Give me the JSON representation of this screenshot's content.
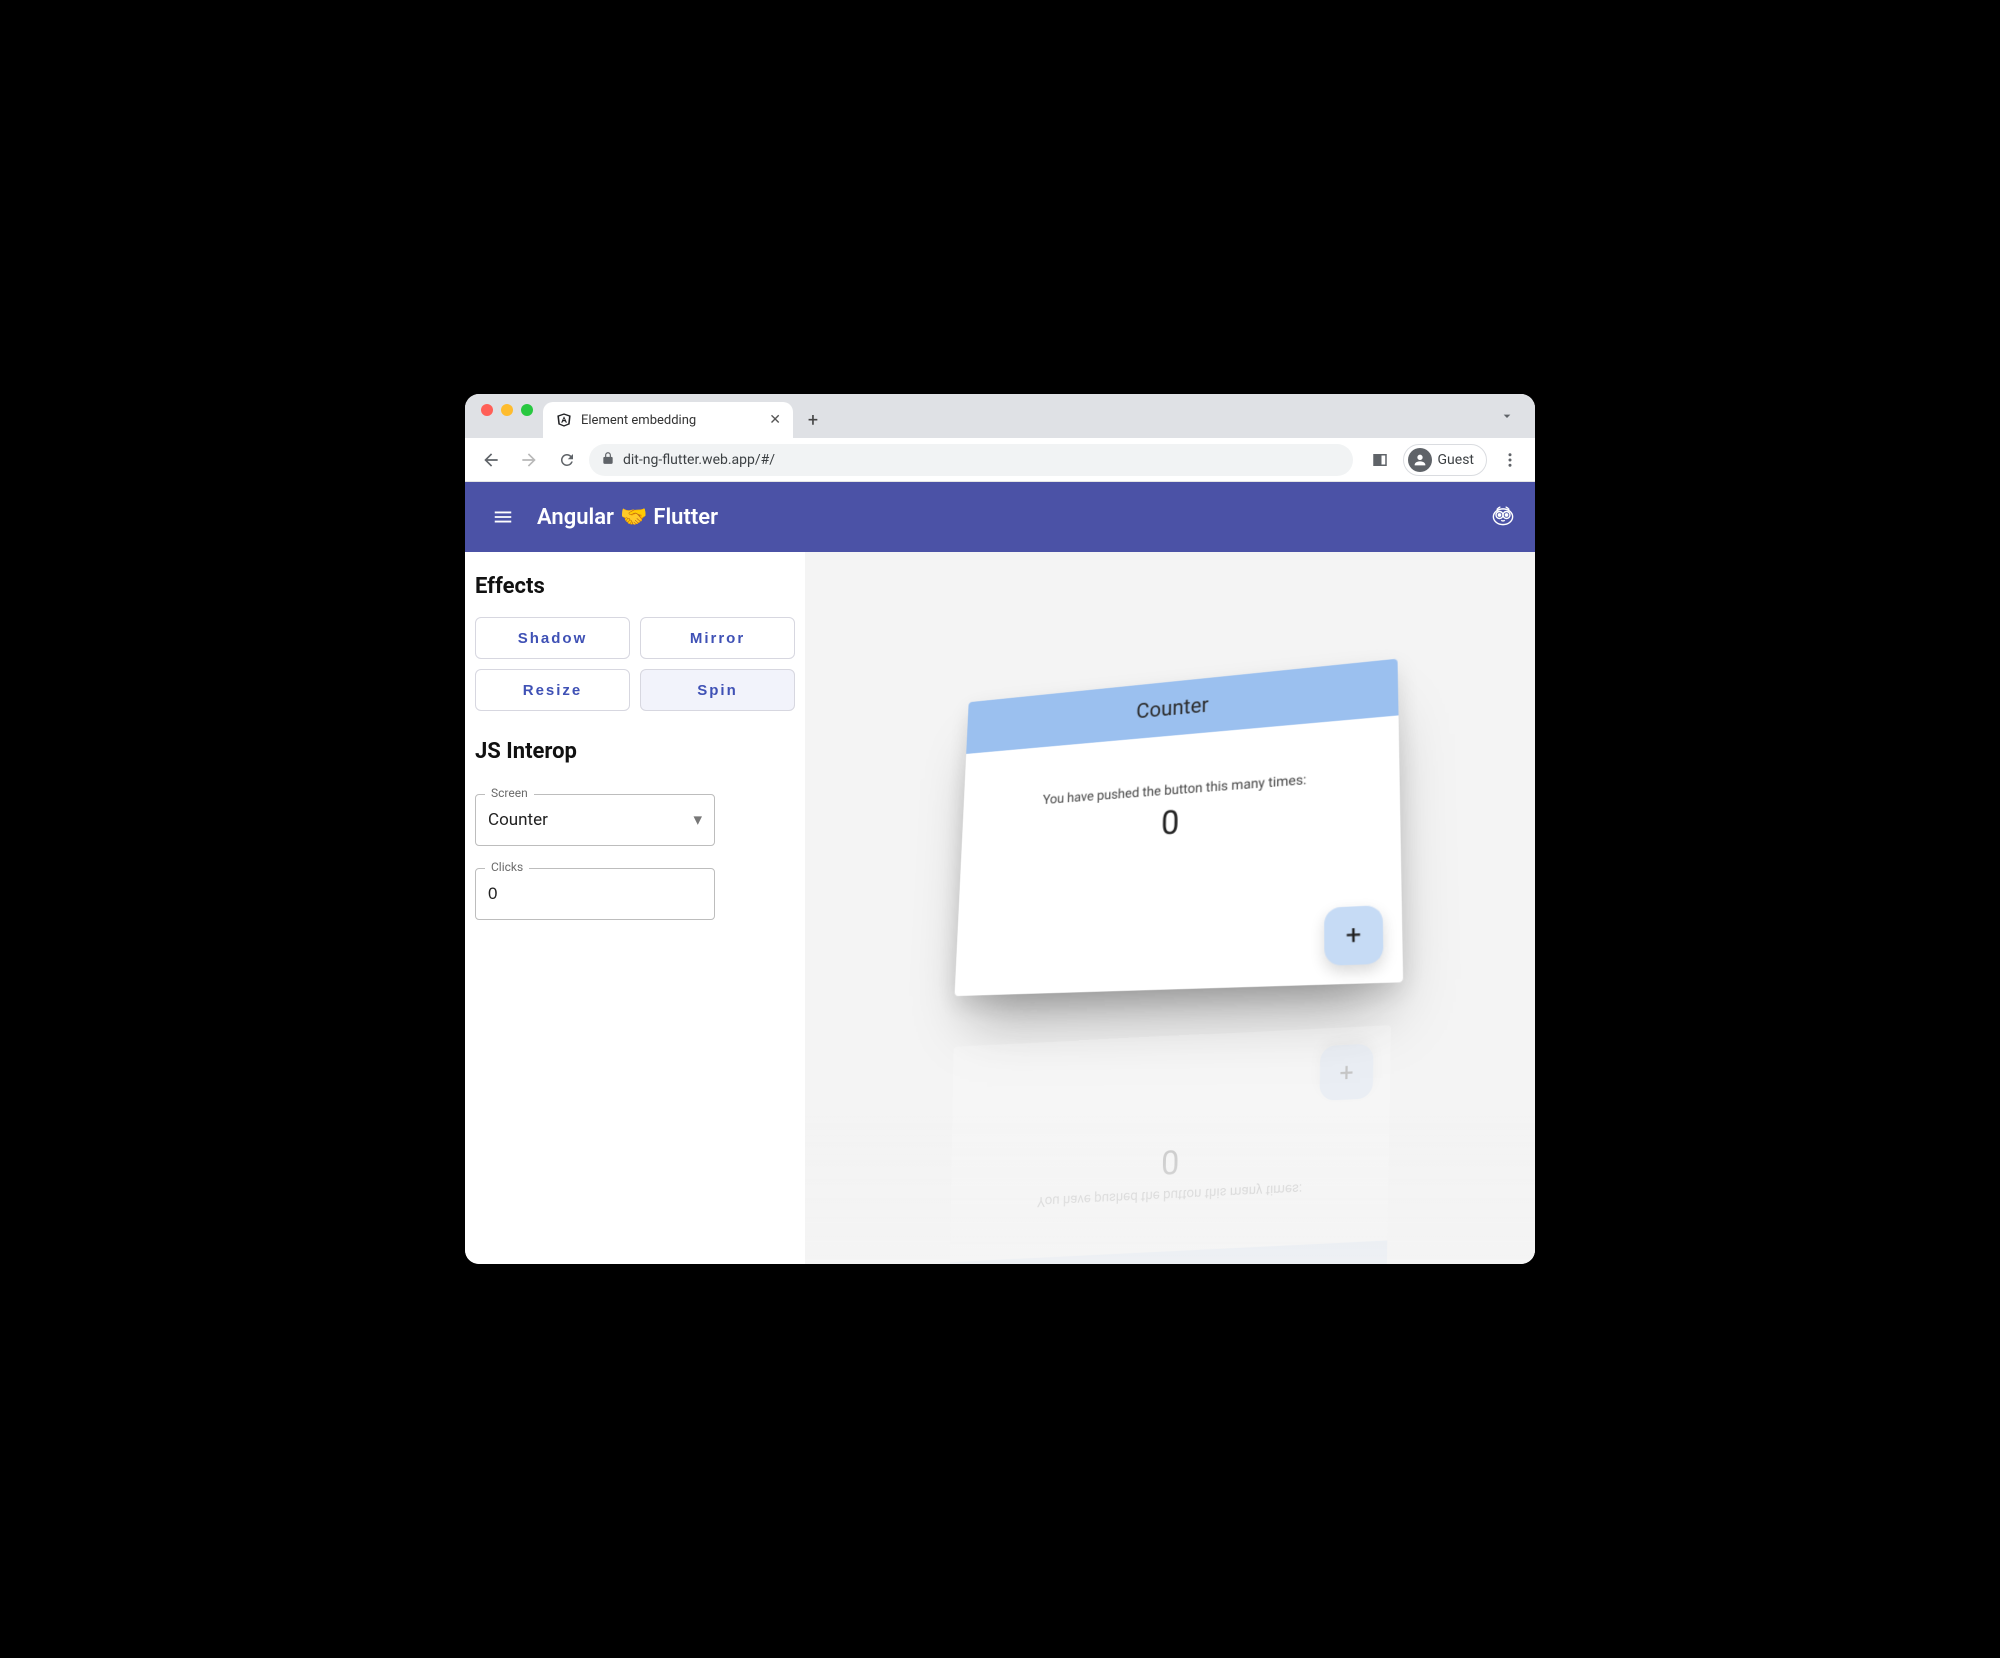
{
  "browser": {
    "tab_title": "Element embedding",
    "url": "dit-ng-flutter.web.app/#/",
    "guest_label": "Guest"
  },
  "header": {
    "title_left": "Angular",
    "title_emoji": "🤝",
    "title_right": "Flutter"
  },
  "sidebar": {
    "effects_heading": "Effects",
    "buttons": {
      "shadow": "Shadow",
      "mirror": "Mirror",
      "resize": "Resize",
      "spin": "Spin"
    },
    "interop_heading": "JS Interop",
    "screen_label": "Screen",
    "screen_value": "Counter",
    "clicks_label": "Clicks",
    "clicks_value": "0"
  },
  "card": {
    "title": "Counter",
    "message": "You have pushed the button this many times:",
    "count": "0",
    "fab": "+"
  },
  "colors": {
    "primary": "#4b52a6",
    "card_header": "#9bc0ef",
    "fab": "#c6dbf5",
    "link": "#3f51b5"
  }
}
